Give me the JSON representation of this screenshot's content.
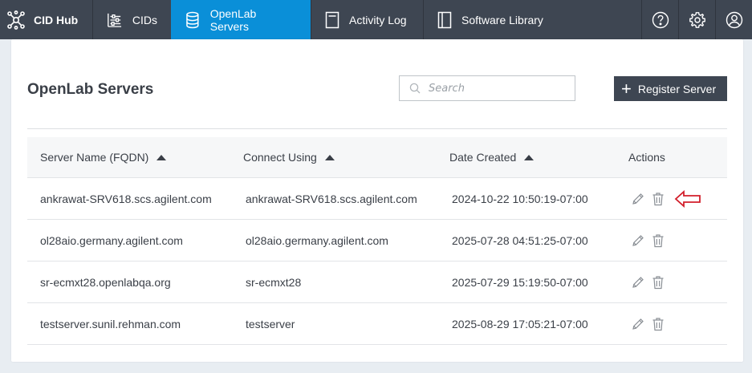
{
  "nav": {
    "brand": "CID Hub",
    "items": [
      {
        "label": "CIDs"
      },
      {
        "label": "OpenLab Servers"
      },
      {
        "label": "Activity Log"
      },
      {
        "label": "Software Library"
      }
    ],
    "icons": [
      "help-icon",
      "settings-icon",
      "user-icon"
    ]
  },
  "page": {
    "title": "OpenLab Servers",
    "search_placeholder": "Search",
    "register_label": "Register Server"
  },
  "table": {
    "columns": [
      "Server Name (FQDN)",
      "Connect Using",
      "Date Created",
      "Actions"
    ],
    "rows": [
      {
        "name": "ankrawat-SRV618.scs.agilent.com",
        "connect": "ankrawat-SRV618.scs.agilent.com",
        "date": "2024-10-22 10:50:19-07:00"
      },
      {
        "name": "ol28aio.germany.agilent.com",
        "connect": "ol28aio.germany.agilent.com",
        "date": "2025-07-28 04:51:25-07:00"
      },
      {
        "name": "sr-ecmxt28.openlabqa.org",
        "connect": "sr-ecmxt28",
        "date": "2025-07-29 15:19:50-07:00"
      },
      {
        "name": "testserver.sunil.rehman.com",
        "connect": "testserver",
        "date": "2025-08-29 17:05:21-07:00"
      }
    ]
  },
  "colors": {
    "nav_bg": "#3e4652",
    "nav_active": "#0a8fd8",
    "annotation_arrow": "#d21f2b"
  }
}
